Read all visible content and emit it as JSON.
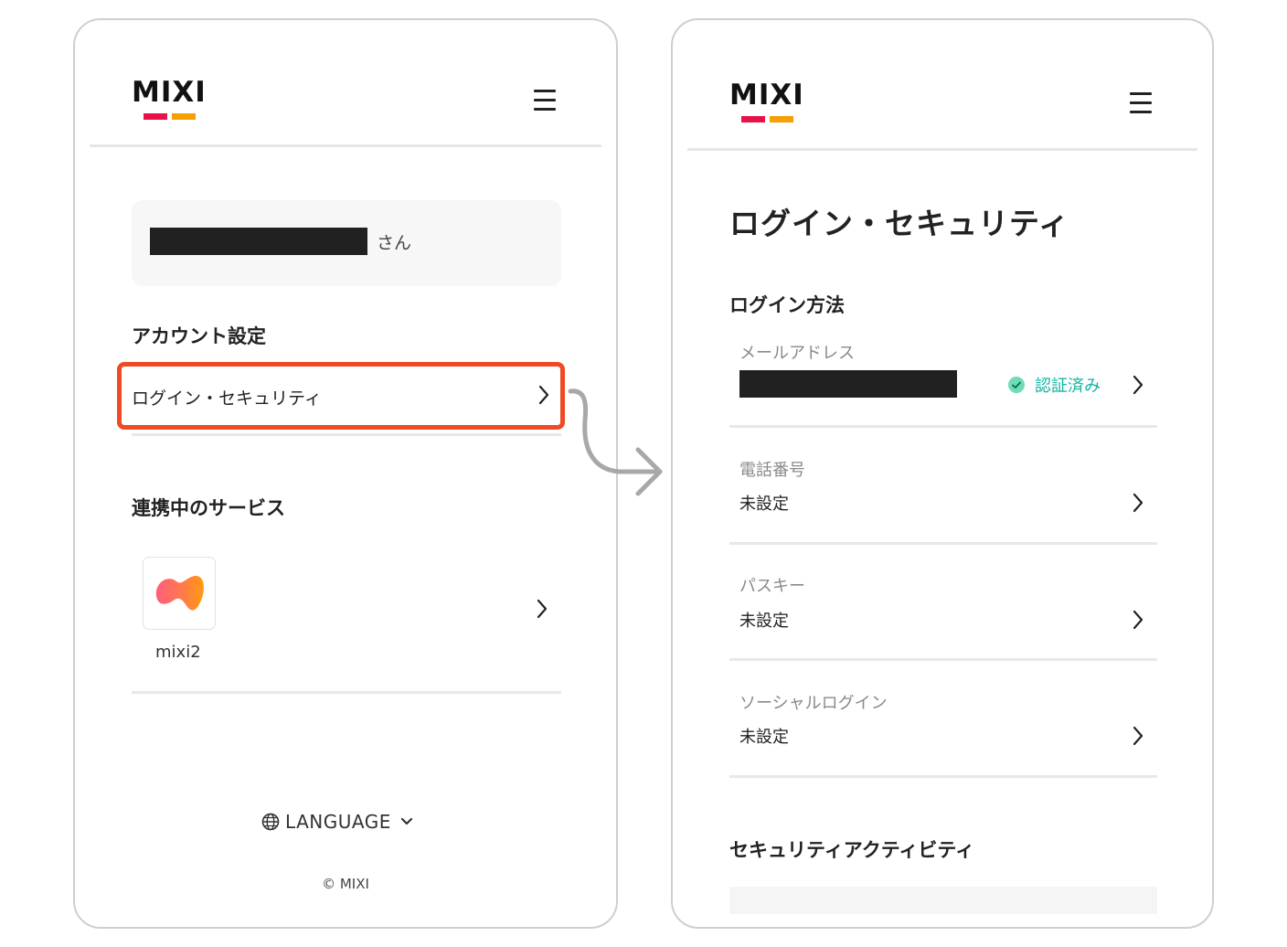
{
  "left": {
    "logo_text": "MIXI",
    "user": {
      "suffix": "さん"
    },
    "account_settings": {
      "title": "アカウント設定",
      "login_security_label": "ログイン・セキュリティ"
    },
    "linked_services": {
      "title": "連携中のサービス",
      "items": [
        {
          "label": "mixi2"
        }
      ]
    },
    "footer": {
      "language_label": "LANGUAGE",
      "copyright": "© MIXI"
    }
  },
  "right": {
    "logo_text": "MIXI",
    "page_title": "ログイン・セキュリティ",
    "login_methods": {
      "title": "ログイン方法",
      "items": [
        {
          "label": "メールアドレス",
          "status": "認証済み"
        },
        {
          "label": "電話番号",
          "value": "未設定"
        },
        {
          "label": "パスキー",
          "value": "未設定"
        },
        {
          "label": "ソーシャルログイン",
          "value": "未設定"
        }
      ]
    },
    "security_activity": {
      "title": "セキュリティアクティビティ"
    }
  },
  "colors": {
    "logo_bar_red": "#e8124a",
    "logo_bar_orange": "#f5a000",
    "highlight_border": "#ee4a25",
    "verified": "#12b3a3",
    "redaction": "#212121"
  },
  "icons": [
    "hamburger-menu-icon",
    "chevron-right-icon",
    "globe-icon",
    "chevron-down-icon",
    "check-circle-icon",
    "curved-arrow-icon",
    "mixi2-app-icon"
  ]
}
